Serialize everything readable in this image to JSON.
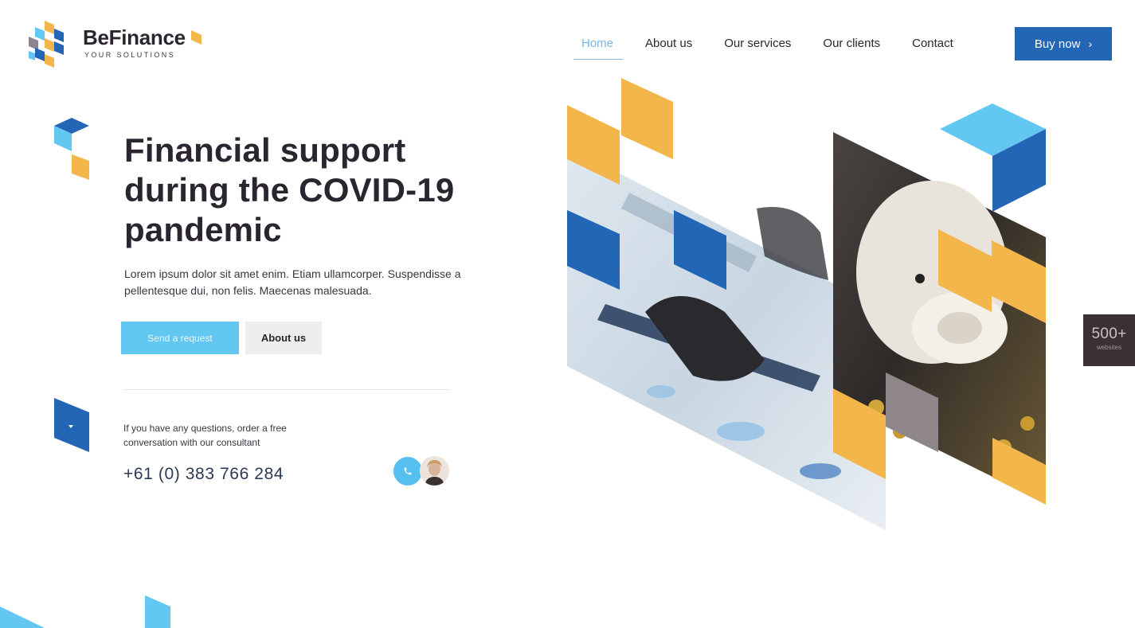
{
  "brand": {
    "name": "BeFinance",
    "tagline": "YOUR SOLUTIONS"
  },
  "nav": {
    "items": [
      {
        "label": "Home",
        "active": true
      },
      {
        "label": "About us",
        "active": false
      },
      {
        "label": "Our services",
        "active": false
      },
      {
        "label": "Our clients",
        "active": false
      },
      {
        "label": "Contact",
        "active": false
      }
    ],
    "buy_label": "Buy now",
    "buy_icon": "chevron-right-icon"
  },
  "hero": {
    "title": "Financial support during the COVID-19 pandemic",
    "text": "Lorem ipsum dolor sit amet enim. Etiam ullamcorper. Suspendisse a pellentesque dui, non felis. Maecenas malesuada.",
    "primary_label": "Send a request",
    "secondary_label": "About us"
  },
  "contact": {
    "note": "If you have any questions, order a free conversation with our consultant",
    "phone": "+61 (0) 383 766 284",
    "call_icon": "phone-icon"
  },
  "side_badge": {
    "value": "500+",
    "label": "websites"
  },
  "colors": {
    "brand_blue": "#2466b6",
    "light_blue": "#62c8f1",
    "yellow": "#f2b64a",
    "text_dark": "#2b2530",
    "active_nav": "#7ab6e6",
    "badge_bg": "#3a3133"
  }
}
